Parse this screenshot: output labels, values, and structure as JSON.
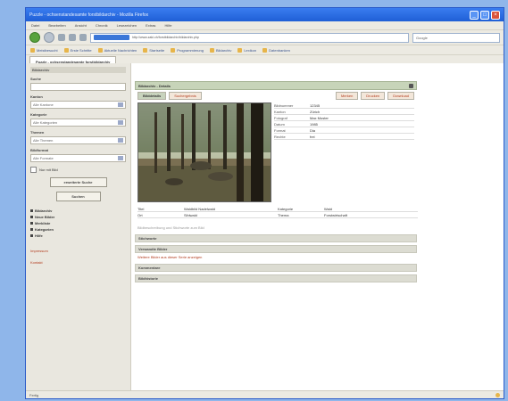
{
  "window": {
    "title": "Puzzle - ochsenstandesamte forstbildarchiv - Mozilla Firefox"
  },
  "menu": [
    "Datei",
    "Bearbeiten",
    "Ansicht",
    "Chronik",
    "Lesezeichen",
    "Extras",
    "Hilfe"
  ],
  "nav": {
    "url": "http://www.zaki.ch/forstbildarchiv/bildarchiv.php",
    "search_placeholder": "Google"
  },
  "bookmarks": [
    "Meistbesucht",
    "Erste Schritte",
    "Aktuelle Nachrichten",
    "Startseite",
    "Programmierung",
    "Bildarchiv",
    "Lexikon",
    "Datenbanken"
  ],
  "tab": {
    "label": "Puzzle - ochsenstandesamte forstbildarchiv"
  },
  "sidebar": {
    "header": "Bildarchiv",
    "search_label": "Suche",
    "fields": [
      {
        "label": "Kanton",
        "value": "Alle Kantone"
      },
      {
        "label": "Kategorie",
        "value": "Alle Kategorien"
      },
      {
        "label": "Themen",
        "value": "Alle Themen"
      },
      {
        "label": "Bildformat",
        "value": "Alle Formate"
      }
    ],
    "checkbox_label": "Nur mit Bild",
    "search_button": "erweiterte Suche",
    "ok_button": "Suchen",
    "links": [
      "Bildarchiv",
      "Neue Bilder",
      "Merkliste",
      "Kategorien",
      "Hilfe"
    ],
    "red_links": [
      "Impressum",
      "Kontakt"
    ]
  },
  "record": {
    "header": "Bildarchiv - Details",
    "tabs": [
      {
        "label": "Bilddetails",
        "active": true,
        "red": false
      },
      {
        "label": "Suchergebnis",
        "active": false,
        "red": true
      },
      {
        "label": "Merken",
        "active": false,
        "red": true
      },
      {
        "label": "Drucken",
        "active": false,
        "red": true
      },
      {
        "label": "Download",
        "active": false,
        "red": true
      }
    ],
    "properties": [
      {
        "k": "Bildnummer",
        "v": "12345"
      },
      {
        "k": "Kanton",
        "v": "Zürich"
      },
      {
        "k": "Fotograf",
        "v": "Max Muster"
      },
      {
        "k": "Datum",
        "v": "1985"
      },
      {
        "k": "Format",
        "v": "Dia"
      },
      {
        "k": "Rechte",
        "v": "frei"
      }
    ],
    "details": [
      [
        "Titel",
        "Waldbild Nadelwald",
        "Kategorie",
        "Wald"
      ],
      [
        "Ort",
        "Sihlwald",
        "Thema",
        "Forstwirtschaft"
      ]
    ],
    "note": "Bildbeschreibung und Stichworte zum Bild",
    "sections": [
      {
        "title": "Stichworte",
        "link": ""
      },
      {
        "title": "Verwandte Bilder",
        "link": "Weitere Bilder aus dieser Serie anzeigen"
      },
      {
        "title": "Kommentare",
        "link": ""
      },
      {
        "title": "Bildhistorie",
        "link": ""
      }
    ]
  },
  "status": {
    "text": "Fertig"
  },
  "colors": {
    "accent": "#2b5bc8",
    "panel": "#c7d4b9",
    "link_red": "#b23a1c"
  }
}
